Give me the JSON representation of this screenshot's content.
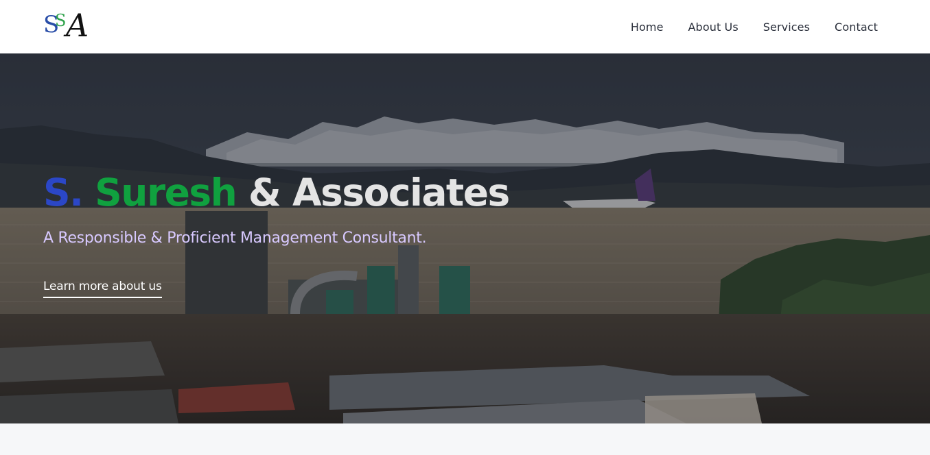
{
  "header": {
    "logo": {
      "letter_1": "S",
      "letter_2": "S",
      "letter_3": "A"
    },
    "nav": [
      {
        "label": "Home"
      },
      {
        "label": "About Us"
      },
      {
        "label": "Services"
      },
      {
        "label": "Contact"
      }
    ]
  },
  "hero": {
    "title_part_1": "S.",
    "title_part_2": "Suresh",
    "title_part_3": "& Associates",
    "subtitle": "A Responsible & Proficient Management Consultant.",
    "cta_label": "Learn more about us"
  },
  "colors": {
    "title_blue": "#2b47c7",
    "title_green": "#10a13f",
    "subtitle_lavender": "#d8c9ff",
    "header_bg": "#ffffff",
    "nav_text": "#2a2f3b"
  },
  "icons": [
    "ssa-logo"
  ]
}
